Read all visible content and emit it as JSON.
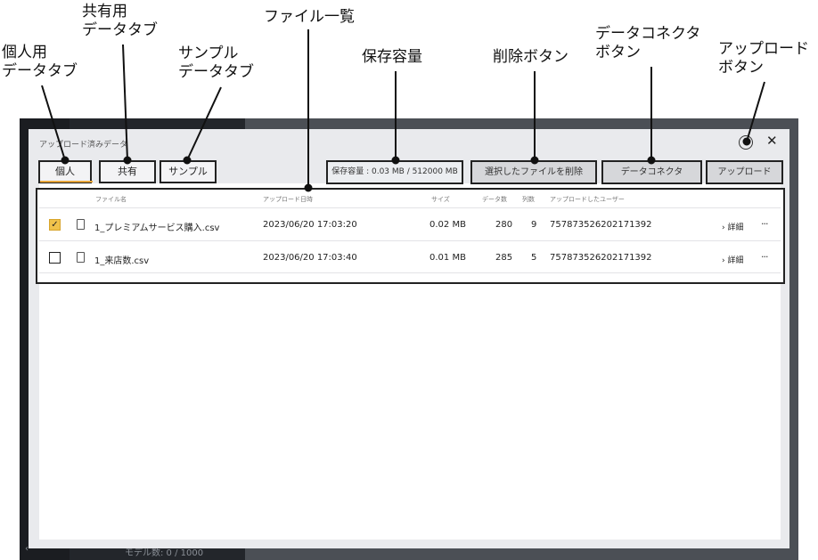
{
  "annotations": {
    "personal_tab": [
      "個人用",
      "データタブ"
    ],
    "shared_tab": [
      "共有用",
      "データタブ"
    ],
    "sample_tab": [
      "サンプル",
      "データタブ"
    ],
    "file_list": "ファイル一覧",
    "storage": "保存容量",
    "delete_button": "削除ボタン",
    "connector_button": [
      "データコネクタ",
      "ボタン"
    ],
    "upload_button": [
      "アップロード",
      "ボタン"
    ]
  },
  "dialog": {
    "title": "アップロード済みデータ",
    "help_icon": "?",
    "close_icon": "✕",
    "tabs": [
      "個人",
      "共有",
      "サンプル"
    ],
    "storage_label": "保存容量 : 0.03 MB / 512000 MB",
    "delete_label": "選択したファイルを削除",
    "connector_label": "データコネクタ",
    "upload_label": "アップロード"
  },
  "table": {
    "headers": [
      "ファイル名",
      "アップロード日時",
      "サイズ",
      "データ数",
      "列数",
      "アップロードしたユーザー"
    ],
    "rows": [
      {
        "checked": true,
        "name": "1_プレミアムサービス購入.csv",
        "date": "2023/06/20 17:03:20",
        "size": "0.02 MB",
        "count": "280",
        "cols": "9",
        "user": "757873526202171392",
        "detail": "詳細",
        "more": "···"
      },
      {
        "checked": false,
        "name": "1_来店数.csv",
        "date": "2023/06/20 17:03:40",
        "size": "0.01 MB",
        "count": "285",
        "cols": "5",
        "user": "757873526202171392",
        "detail": "詳細",
        "more": "···"
      }
    ]
  },
  "background": {
    "model_count": "モデル数: 0 / 1000",
    "chevron": "‹"
  },
  "colors": {
    "accent": "#e9a73a",
    "checkbox_checked": "#f0c24b",
    "dialog_bg": "#e9eaed",
    "app_dark": "#23262b"
  }
}
